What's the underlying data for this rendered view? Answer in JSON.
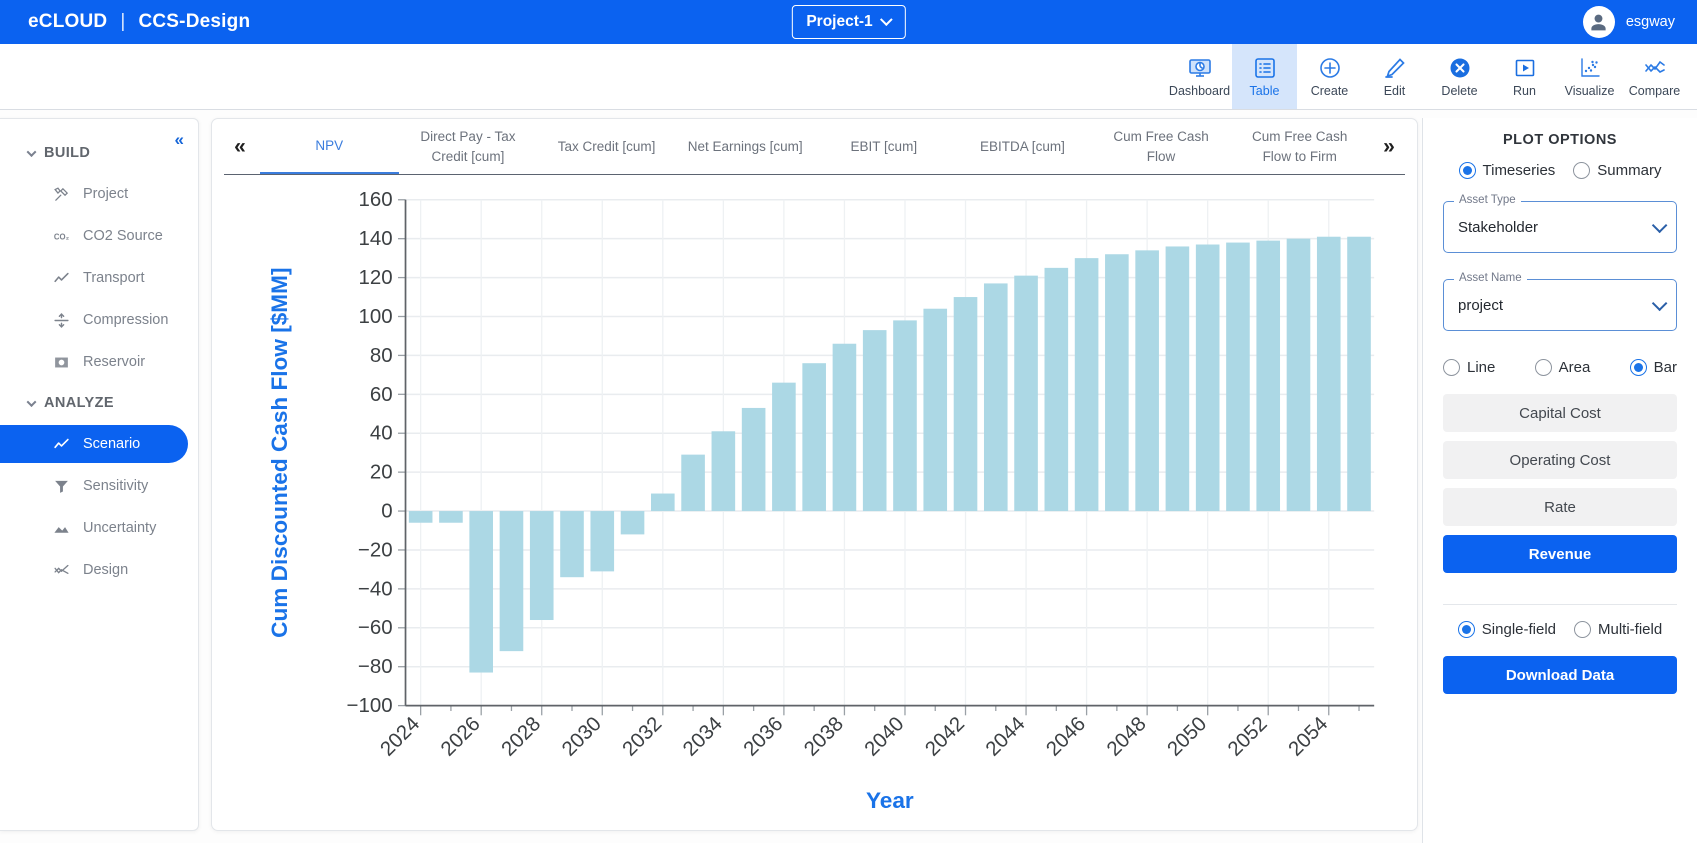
{
  "header": {
    "brand_primary": "eCLOUD",
    "brand_sep": "|",
    "brand_secondary": "CCS-Design",
    "project_label": "Project-1",
    "user_name": "esgway"
  },
  "toolbar": {
    "items": [
      {
        "label": "Dashboard",
        "icon": "dashboard-icon",
        "active": false
      },
      {
        "label": "Table",
        "icon": "table-icon",
        "active": true
      },
      {
        "label": "Create",
        "icon": "create-plus-icon",
        "active": false
      },
      {
        "label": "Edit",
        "icon": "edit-pencil-icon",
        "active": false
      },
      {
        "label": "Delete",
        "icon": "delete-x-icon",
        "active": false
      },
      {
        "label": "Run",
        "icon": "run-play-icon",
        "active": false
      },
      {
        "label": "Visualize",
        "icon": "visualize-scatter-icon",
        "active": false
      },
      {
        "label": "Compare",
        "icon": "compare-lines-icon",
        "active": false
      }
    ]
  },
  "sidebar": {
    "collapse_glyph": "«",
    "groups": [
      {
        "label": "BUILD",
        "items": [
          {
            "label": "Project",
            "icon": "tools-icon",
            "active": false
          },
          {
            "label": "CO2 Source",
            "icon": "co2-icon",
            "active": false
          },
          {
            "label": "Transport",
            "icon": "trend-line-icon",
            "active": false
          },
          {
            "label": "Compression",
            "icon": "compression-icon",
            "active": false
          },
          {
            "label": "Reservoir",
            "icon": "reservoir-icon",
            "active": false
          }
        ]
      },
      {
        "label": "ANALYZE",
        "items": [
          {
            "label": "Scenario",
            "icon": "trend-line-icon",
            "active": true
          },
          {
            "label": "Sensitivity",
            "icon": "funnel-icon",
            "active": false
          },
          {
            "label": "Uncertainty",
            "icon": "mountain-icon",
            "active": false
          },
          {
            "label": "Design",
            "icon": "waves-icon",
            "active": false
          }
        ]
      }
    ]
  },
  "main": {
    "prev_glyph": "«",
    "next_glyph": "»",
    "tabs": [
      {
        "label": "NPV",
        "active": true
      },
      {
        "label": "Direct Pay - Tax Credit [cum]",
        "active": false
      },
      {
        "label": "Tax Credit [cum]",
        "active": false
      },
      {
        "label": "Net Earnings [cum]",
        "active": false
      },
      {
        "label": "EBIT [cum]",
        "active": false
      },
      {
        "label": "EBITDA [cum]",
        "active": false
      },
      {
        "label": "Cum Free Cash Flow",
        "active": false
      },
      {
        "label": "Cum Free Cash Flow to Firm",
        "active": false
      }
    ]
  },
  "chart_data": {
    "type": "bar",
    "title": "",
    "xlabel": "Year",
    "ylabel": "Cum Discounted Cash Flow [$MM]",
    "ylim": [
      -100,
      160
    ],
    "yticks": [
      -100,
      -80,
      -60,
      -40,
      -20,
      0,
      20,
      40,
      60,
      80,
      100,
      120,
      140,
      160
    ],
    "xtick_labels": [
      "2024",
      "2026",
      "2028",
      "2030",
      "2032",
      "2034",
      "2036",
      "2038",
      "2040",
      "2042",
      "2044",
      "2046",
      "2048",
      "2050",
      "2052",
      "2054"
    ],
    "grid": true,
    "legend": "none",
    "bar_color": "#ACD8E5",
    "axis_label_color": "#1a73e8",
    "categories": [
      2024,
      2025,
      2026,
      2027,
      2028,
      2029,
      2030,
      2031,
      2032,
      2033,
      2034,
      2035,
      2036,
      2037,
      2038,
      2039,
      2040,
      2041,
      2042,
      2043,
      2044,
      2045,
      2046,
      2047,
      2048,
      2049,
      2050,
      2051,
      2052,
      2053,
      2054,
      2055
    ],
    "values": [
      -6,
      -6,
      -83,
      -72,
      -56,
      -34,
      -31,
      -12,
      9,
      29,
      41,
      53,
      66,
      76,
      86,
      93,
      98,
      104,
      110,
      117,
      121,
      125,
      130,
      132,
      134,
      136,
      137,
      138,
      139,
      140,
      141,
      141
    ]
  },
  "plot_options": {
    "title": "PLOT OPTIONS",
    "view_modes": [
      {
        "label": "Timeseries",
        "selected": true
      },
      {
        "label": "Summary",
        "selected": false
      }
    ],
    "asset_type": {
      "legend": "Asset Type",
      "value": "Stakeholder"
    },
    "asset_name": {
      "legend": "Asset Name",
      "value": "project"
    },
    "chart_types": [
      {
        "label": "Line",
        "selected": false
      },
      {
        "label": "Area",
        "selected": false
      },
      {
        "label": "Bar",
        "selected": true
      }
    ],
    "categories": [
      {
        "label": "Capital Cost",
        "selected": false
      },
      {
        "label": "Operating Cost",
        "selected": false
      },
      {
        "label": "Rate",
        "selected": false
      },
      {
        "label": "Revenue",
        "selected": true
      }
    ],
    "field_modes": [
      {
        "label": "Single-field",
        "selected": true
      },
      {
        "label": "Multi-field",
        "selected": false
      }
    ],
    "download_label": "Download Data"
  }
}
